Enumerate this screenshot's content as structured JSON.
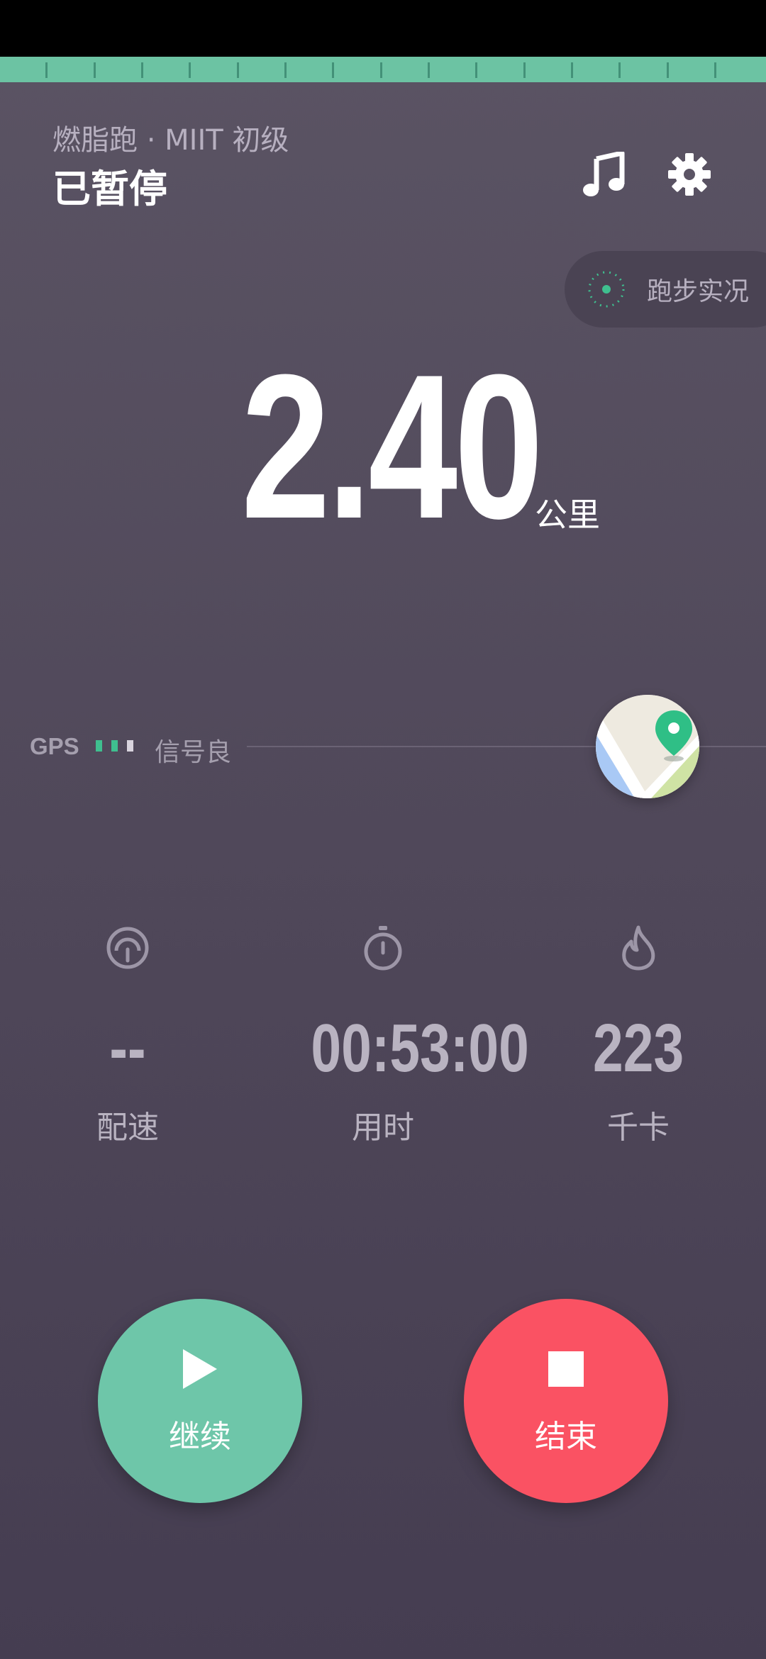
{
  "header": {
    "subtitle": "燃脂跑 · MIIT 初级",
    "status": "已暂停"
  },
  "toolbar": {
    "music_icon": "music-note-icon",
    "settings_icon": "gear-icon"
  },
  "live_status": {
    "label": "跑步实况",
    "icon": "radar-icon"
  },
  "distance": {
    "value": "2.40",
    "unit": "公里"
  },
  "gps": {
    "label": "GPS",
    "signal_text": "信号良",
    "signal_bars": 3
  },
  "map": {
    "icon": "map-pin-icon"
  },
  "stats": {
    "pace": {
      "value": "--",
      "label": "配速",
      "icon": "speedometer-icon"
    },
    "time": {
      "value": "00:53:00",
      "label": "用时",
      "icon": "stopwatch-icon"
    },
    "calories": {
      "value": "223",
      "label": "千卡",
      "icon": "flame-icon"
    }
  },
  "actions": {
    "resume_label": "继续",
    "end_label": "结束"
  },
  "colors": {
    "accent_green": "#6ec6a9",
    "danger_red": "#fa5263",
    "background": "#564f60"
  }
}
